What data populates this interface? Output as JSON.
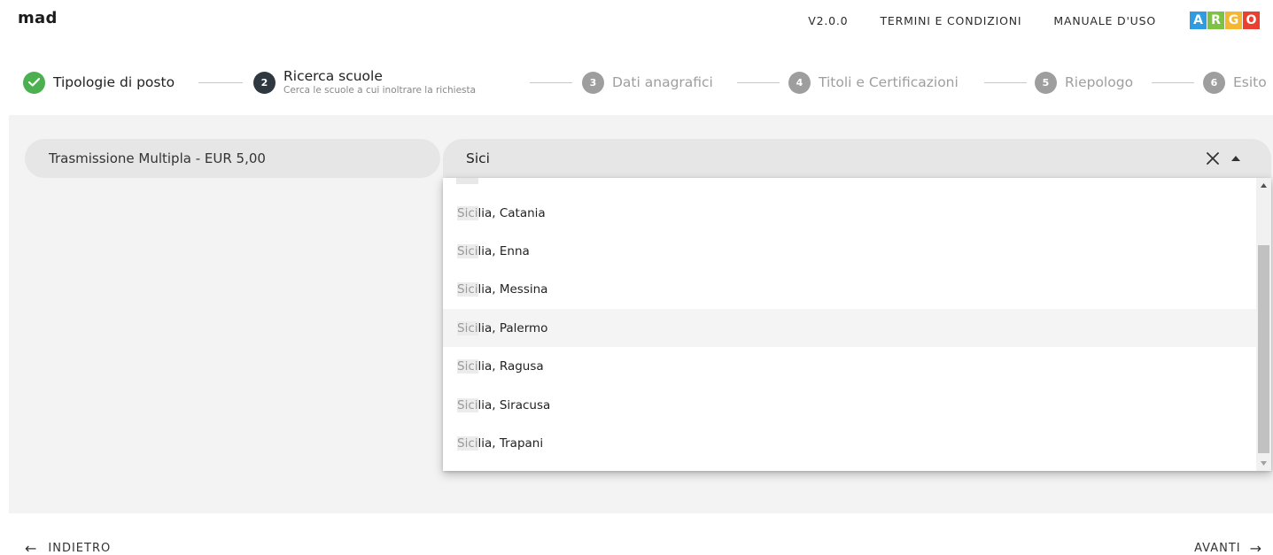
{
  "header": {
    "app_title": "mad",
    "version": "V2.0.0",
    "terms": "TERMINI E CONDIZIONI",
    "manual": "MANUALE D'USO",
    "logo_letters": [
      "A",
      "R",
      "G",
      "O"
    ]
  },
  "stepper": {
    "steps": [
      {
        "number": "1",
        "label": "Tipologie di posto",
        "state": "done",
        "icon": "check-icon"
      },
      {
        "number": "2",
        "label": "Ricerca scuole",
        "sublabel": "Cerca le scuole a cui inoltrare la richiesta",
        "state": "active"
      },
      {
        "number": "3",
        "label": "Dati anagrafici",
        "state": "pending"
      },
      {
        "number": "4",
        "label": "Titoli e Certificazioni",
        "state": "pending"
      },
      {
        "number": "5",
        "label": "Riepologo",
        "state": "pending"
      },
      {
        "number": "6",
        "label": "Esito",
        "state": "pending"
      }
    ]
  },
  "service": {
    "label": "Trasmissione Multipla - EUR 5,00"
  },
  "search": {
    "value": "Sici"
  },
  "dropdown": {
    "highlight": "Sici",
    "options": [
      {
        "match": "Sici",
        "rest": "lia, Catania"
      },
      {
        "match": "Sici",
        "rest": "lia, Enna"
      },
      {
        "match": "Sici",
        "rest": "lia, Messina"
      },
      {
        "match": "Sici",
        "rest": "lia, Palermo"
      },
      {
        "match": "Sici",
        "rest": "lia, Ragusa"
      },
      {
        "match": "Sici",
        "rest": "lia, Siracusa"
      },
      {
        "match": "Sici",
        "rest": "lia, Trapani"
      }
    ],
    "hovered_index": 3
  },
  "footer": {
    "back": "INDIETRO",
    "next": "AVANTI"
  },
  "colors": {
    "done": "#4caf50",
    "active": "#2f3740",
    "pending": "#9e9e9e",
    "argo_a": "#2f9be0",
    "argo_r": "#7dc242",
    "argo_g": "#f5b731",
    "argo_o": "#e9402f"
  }
}
